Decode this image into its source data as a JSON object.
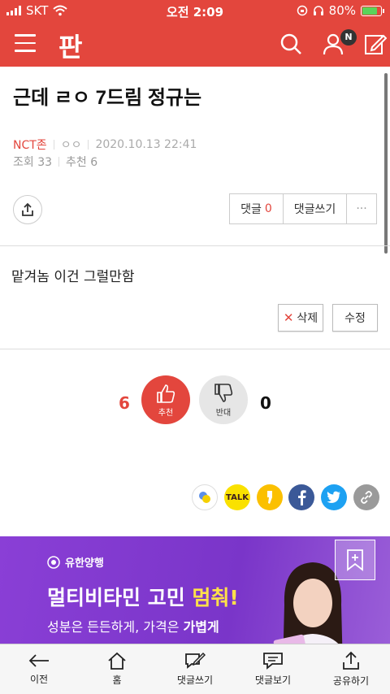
{
  "status_bar": {
    "carrier": "SKT",
    "time": "오전 2:09",
    "battery": "80%"
  },
  "app": {
    "logo": "판",
    "notification_badge": "N"
  },
  "post": {
    "title": "근데 ㄹㅇ 7드림 정규는",
    "author": "NCT존",
    "nickname": "ㅇㅇ",
    "datetime": "2020.10.13 22:41",
    "views_label": "조회 33",
    "recommend_label": "추천 6",
    "body": "맡겨놈 이건 그럴만함"
  },
  "actions": {
    "comment_label": "댓글",
    "comment_count": "0",
    "write_comment": "댓글쓰기",
    "more": "···",
    "delete": "삭제",
    "edit": "수정"
  },
  "vote": {
    "up_count": "6",
    "up_label": "추천",
    "down_count": "0",
    "down_label": "반대"
  },
  "social": [
    "band-icon",
    "kakaotalk-icon",
    "kakaostory-icon",
    "facebook-icon",
    "twitter-icon",
    "link-icon"
  ],
  "social_labels": {
    "kakaotalk": "TALK"
  },
  "ad": {
    "brand": "유한양행",
    "headline_plain": "멀티비타민 고민 ",
    "headline_emph": "멈춰!",
    "sub_a": "성분은 든든하게, 가격은 ",
    "sub_b": "가볍게"
  },
  "tabbar": [
    {
      "label": "이전",
      "icon": "back-arrow-icon"
    },
    {
      "label": "홈",
      "icon": "home-icon"
    },
    {
      "label": "댓글쓰기",
      "icon": "write-comment-icon"
    },
    {
      "label": "댓글보기",
      "icon": "view-comments-icon"
    },
    {
      "label": "공유하기",
      "icon": "share-icon"
    }
  ],
  "colors": {
    "brand_red": "#e3463d",
    "ad_purple": "#8a3fd6"
  }
}
